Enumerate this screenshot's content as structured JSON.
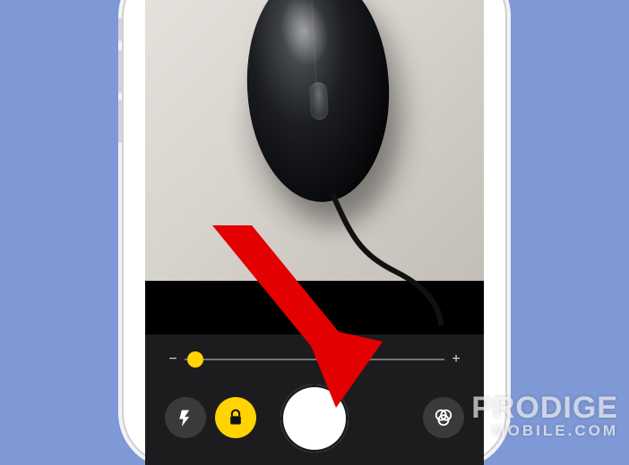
{
  "viewfinder": {
    "subject": "black-computer-mouse"
  },
  "exposure": {
    "minus_label": "−",
    "plus_label": "+",
    "value_percent": 1
  },
  "controls": {
    "flash_icon": "flash-icon",
    "lock_icon": "lock-icon",
    "shutter": "shutter-button",
    "filters_icon": "filters-icon"
  },
  "watermark": {
    "line1": "PRODIGE",
    "line2": "MOBILE.COM"
  },
  "annotation": {
    "arrow": "red-arrow"
  },
  "colors": {
    "accent_yellow": "#ffd400",
    "arrow_red": "#e30000",
    "page_bg": "#7f99d6"
  }
}
